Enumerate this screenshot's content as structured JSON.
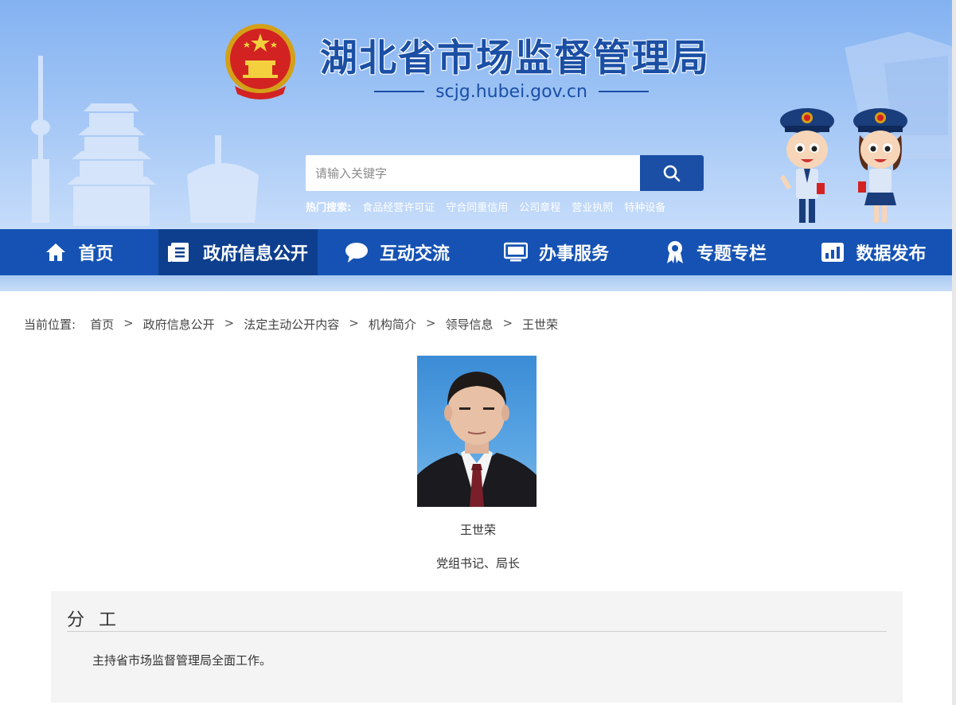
{
  "header": {
    "site_title": "湖北省市场监督管理局",
    "site_domain": "scjg.hubei.gov.cn",
    "search_placeholder": "请输入关键字",
    "hot_search_label": "热门搜索:",
    "hot_search_items": [
      "食品经营许可证",
      "守合同重信用",
      "公司章程",
      "营业执照",
      "特种设备"
    ]
  },
  "nav": {
    "items": [
      {
        "label": "首页",
        "icon": "home-icon"
      },
      {
        "label": "政府信息公开",
        "icon": "document-list-icon",
        "active": true
      },
      {
        "label": "互动交流",
        "icon": "chat-bubble-icon"
      },
      {
        "label": "办事服务",
        "icon": "monitor-icon"
      },
      {
        "label": "专题专栏",
        "icon": "award-ribbon-icon"
      },
      {
        "label": "数据发布",
        "icon": "bar-chart-icon"
      }
    ]
  },
  "breadcrumb": {
    "label": "当前位置:",
    "items": [
      "首页",
      "政府信息公开",
      "法定主动公开内容",
      "机构简介",
      "领导信息",
      "王世荣"
    ],
    "separator": ">"
  },
  "profile": {
    "name": "王世荣",
    "title": "党组书记、局长"
  },
  "duties": {
    "heading": "分工",
    "text": "主持省市场监督管理局全面工作。"
  },
  "colors": {
    "brand_blue": "#1552b3",
    "nav_active": "#0e3f8e",
    "title_blue": "#1b4fa5"
  }
}
